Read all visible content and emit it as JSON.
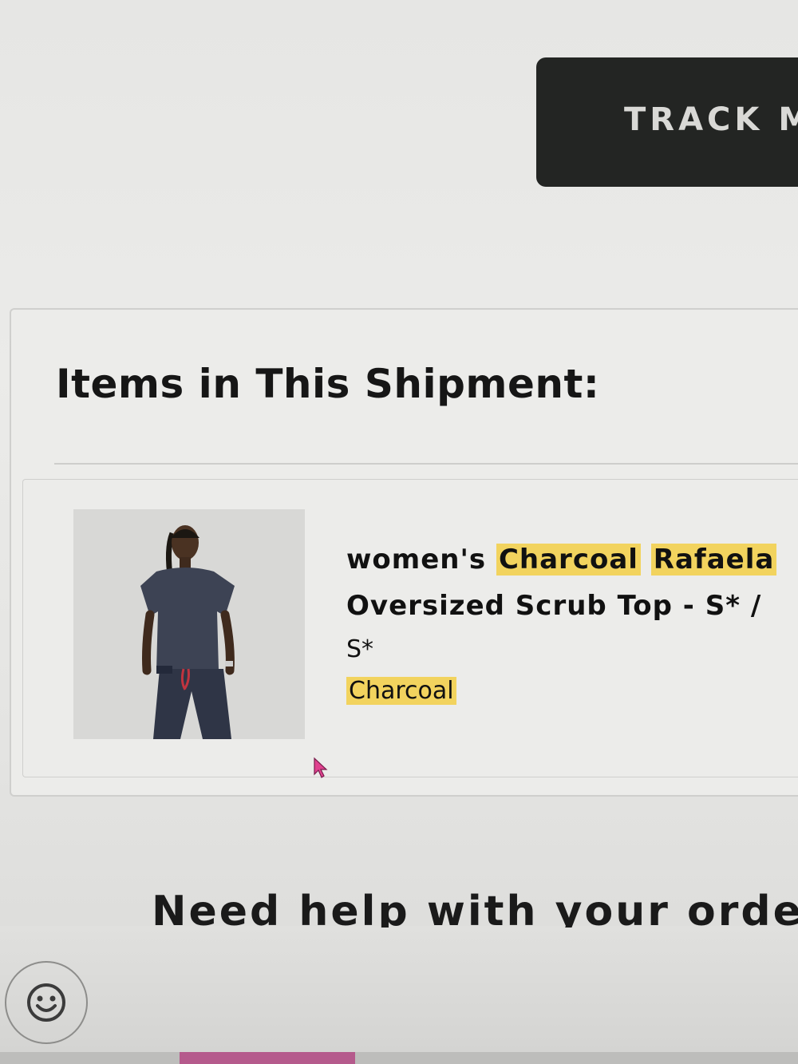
{
  "header": {
    "track_button_label": "TRACK M"
  },
  "shipment": {
    "section_title": "Items in This Shipment:",
    "item": {
      "name_prefix": "women's",
      "name_highlight_1": "Charcoal",
      "name_highlight_2": "Rafaela",
      "name_line_2": "Oversized Scrub Top - S* /",
      "size": "S*",
      "color": "Charcoal",
      "image_alt": "model wearing charcoal scrubs"
    }
  },
  "help": {
    "heading": "Need help with your order?"
  },
  "colors": {
    "button_bg": "#232523",
    "highlight": "#f2d35e",
    "text": "#111111"
  },
  "icons": {
    "emoji": "smiley-icon",
    "cursor": "mouse-pointer-icon"
  }
}
